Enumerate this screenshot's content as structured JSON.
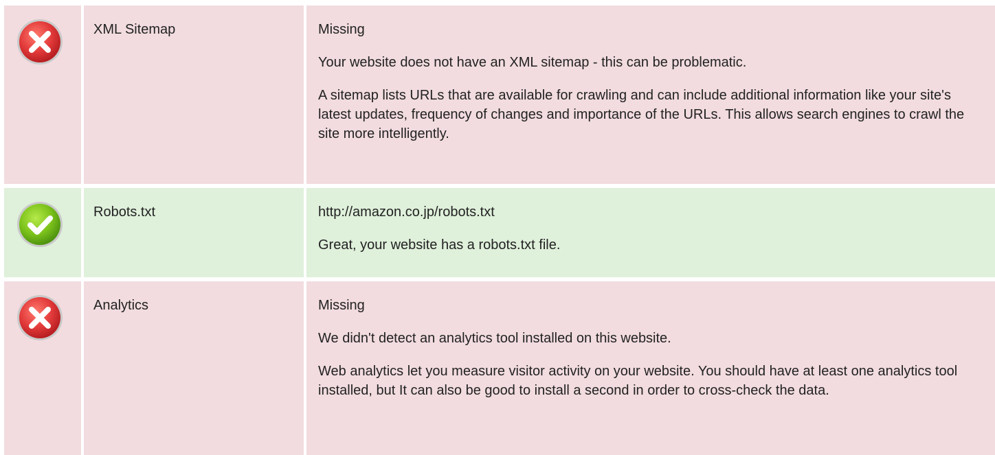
{
  "colors": {
    "fail_bg": "#f2dcdf",
    "pass_bg": "#dff0db",
    "fail_icon": "#e23a3a",
    "pass_icon": "#7cc21b"
  },
  "checks": [
    {
      "status": "fail",
      "icon": "error-icon",
      "name": "XML Sitemap",
      "value": "Missing",
      "paragraphs": [
        "Your website does not have an XML sitemap - this can be problematic.",
        "A sitemap lists URLs that are available for crawling and can include additional information like your site's latest updates, frequency of changes and importance of the URLs. This allows search engines to crawl the site more intelligently."
      ]
    },
    {
      "status": "pass",
      "icon": "success-icon",
      "name": "Robots.txt",
      "value": "http://amazon.co.jp/robots.txt",
      "paragraphs": [
        "Great, your website has a robots.txt file."
      ]
    },
    {
      "status": "fail",
      "icon": "error-icon",
      "name": "Analytics",
      "value": "Missing",
      "paragraphs": [
        "We didn't detect an analytics tool installed on this website.",
        "Web analytics let you measure visitor activity on your website. You should have at least one analytics tool installed, but It can also be good to install a second in order to cross-check the data."
      ]
    }
  ]
}
